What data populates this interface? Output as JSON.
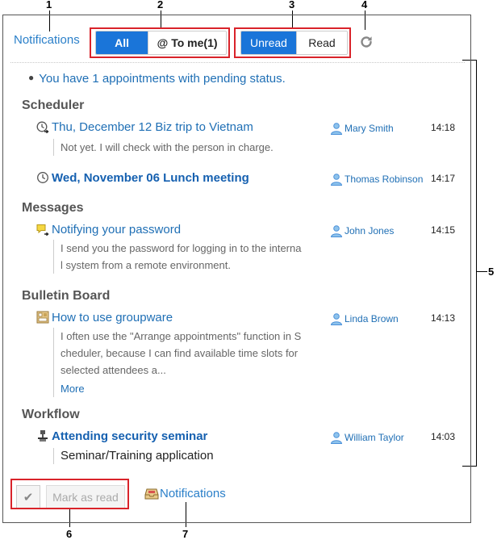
{
  "callouts": [
    "1",
    "2",
    "3",
    "4",
    "5",
    "6",
    "7"
  ],
  "header": {
    "title": "Notifications",
    "source_filter": {
      "all": "All",
      "to_me": "@ To me(1)"
    },
    "status_filter": {
      "unread": "Unread",
      "read": "Read"
    },
    "refresh_icon": "refresh-icon"
  },
  "pending_message": "You have 1 appointments with pending status.",
  "sections": {
    "scheduler": {
      "title": "Scheduler",
      "items": [
        {
          "icon": "clock-arrow-icon",
          "title": "Thu, December 12 Biz trip to Vietnam",
          "user": "Mary Smith",
          "time": "14:18",
          "body": "Not yet. I will check with the person in charge.",
          "unread": false
        },
        {
          "icon": "clock-icon",
          "title": "Wed, November 06 Lunch meeting",
          "user": "Thomas Robinson",
          "time": "14:17",
          "unread": true
        }
      ]
    },
    "messages": {
      "title": "Messages",
      "items": [
        {
          "icon": "message-arrow-icon",
          "title": "Notifying your password",
          "user": "John Jones",
          "time": "14:15",
          "body_line1": "I send you the password for logging in to the interna",
          "body_line2": "l system from a remote environment.",
          "unread": false
        }
      ]
    },
    "bulletin": {
      "title": "Bulletin Board",
      "items": [
        {
          "icon": "bulletin-icon",
          "title": "How to use groupware",
          "user": "Linda Brown",
          "time": "14:13",
          "body_line1": "I often use the \"Arrange appointments\" function in S",
          "body_line2": "cheduler, because I can find available time slots for",
          "body_line3": "selected attendees a...",
          "more": "More",
          "unread": false
        }
      ]
    },
    "workflow": {
      "title": "Workflow",
      "items": [
        {
          "icon": "workflow-icon",
          "title": "Attending security seminar",
          "user": "William Taylor",
          "time": "14:03",
          "body": "Seminar/Training application",
          "unread": true
        }
      ]
    }
  },
  "footer": {
    "check_icon": "check-icon",
    "mark_as_read": "Mark as read",
    "notifications_link": "Notifications"
  },
  "colors": {
    "accent": "#1a75d9",
    "link": "#1f6fb5",
    "callout_box": "#d9232a"
  }
}
